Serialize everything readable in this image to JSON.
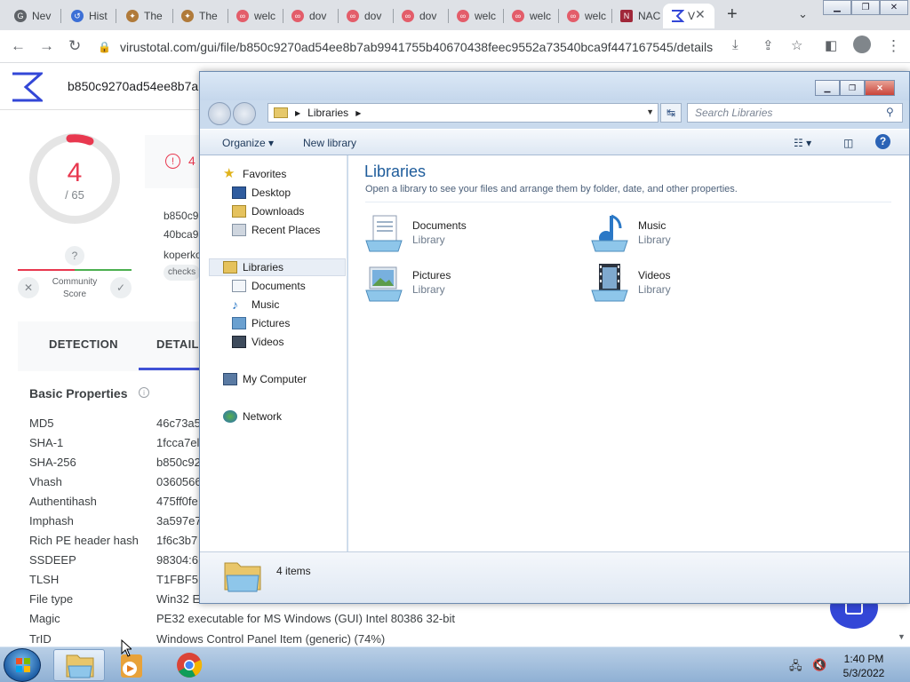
{
  "browser": {
    "tabs": [
      {
        "label": "Nev",
        "icon": "google-icon",
        "color": "#5f6368"
      },
      {
        "label": "Hist",
        "icon": "history-icon",
        "color": "#3c6fd6"
      },
      {
        "label": "The",
        "icon": "puzzle-icon",
        "color": "#b07a3a"
      },
      {
        "label": "The",
        "icon": "puzzle-icon",
        "color": "#b07a3a"
      },
      {
        "label": "welc",
        "icon": "site-icon",
        "color": "#e35d6a"
      },
      {
        "label": "dov",
        "icon": "site-icon",
        "color": "#e35d6a"
      },
      {
        "label": "dov",
        "icon": "site-icon",
        "color": "#e35d6a"
      },
      {
        "label": "dov",
        "icon": "site-icon",
        "color": "#e35d6a"
      },
      {
        "label": "welc",
        "icon": "site-icon",
        "color": "#e35d6a"
      },
      {
        "label": "welc",
        "icon": "site-icon",
        "color": "#e35d6a"
      },
      {
        "label": "welc",
        "icon": "site-icon",
        "color": "#e35d6a"
      },
      {
        "label": "NAC",
        "icon": "site-icon",
        "color": "#a0283a"
      },
      {
        "label": "V",
        "icon": "virustotal-icon",
        "color": "#3347d7"
      }
    ],
    "url": "virustotal.com/gui/file/b850c9270ad54ee8b7ab9941755b40670438feec9552a73540bca9f447167545/details"
  },
  "vt": {
    "hash": "b850c9270ad54ee8b7a",
    "score": "4",
    "total": "/ 65",
    "community_help": "?",
    "community_label_1": "Community",
    "community_label_2": "Score",
    "alert_count": "4",
    "hash_line_1": "b850c9",
    "hash_line_2": "40bca9",
    "name_line": "koperko",
    "tag": "checks",
    "tabs": [
      "DETECTION",
      "DETAIL"
    ],
    "basic_title": "Basic Properties",
    "properties": [
      {
        "k": "MD5",
        "v": "46c73a5"
      },
      {
        "k": "SHA-1",
        "v": "1fcca7el"
      },
      {
        "k": "SHA-256",
        "v": "b850c92"
      },
      {
        "k": "Vhash",
        "v": "0360566"
      },
      {
        "k": "Authentihash",
        "v": "475ff0fe"
      },
      {
        "k": "Imphash",
        "v": "3a597e7"
      },
      {
        "k": "Rich PE header hash",
        "v": "1f6c3b7"
      },
      {
        "k": "SSDEEP",
        "v": "98304:6"
      },
      {
        "k": "TLSH",
        "v": "T1FBF5"
      },
      {
        "k": "File type",
        "v": "Win32 E"
      },
      {
        "k": "Magic",
        "v": "PE32 executable for MS Windows (GUI) Intel 80386 32-bit"
      },
      {
        "k": "TrID",
        "v": "Windows Control Panel Item (generic) (74%)"
      }
    ]
  },
  "explorer": {
    "breadcrumb": "Libraries",
    "search_placeholder": "Search Libraries",
    "organize": "Organize",
    "new_library": "New library",
    "nav": {
      "favorites": "Favorites",
      "desktop": "Desktop",
      "downloads": "Downloads",
      "recent": "Recent Places",
      "libraries": "Libraries",
      "documents": "Documents",
      "music": "Music",
      "pictures": "Pictures",
      "videos": "Videos",
      "computer": "My Computer",
      "network": "Network"
    },
    "title": "Libraries",
    "subtitle": "Open a library to see your files and arrange them by folder, date, and other properties.",
    "items": [
      {
        "name": "Documents",
        "type": "Library"
      },
      {
        "name": "Music",
        "type": "Library"
      },
      {
        "name": "Pictures",
        "type": "Library"
      },
      {
        "name": "Videos",
        "type": "Library"
      }
    ],
    "status": "4 items"
  },
  "taskbar": {
    "time": "1:40 PM",
    "date": "5/3/2022"
  }
}
